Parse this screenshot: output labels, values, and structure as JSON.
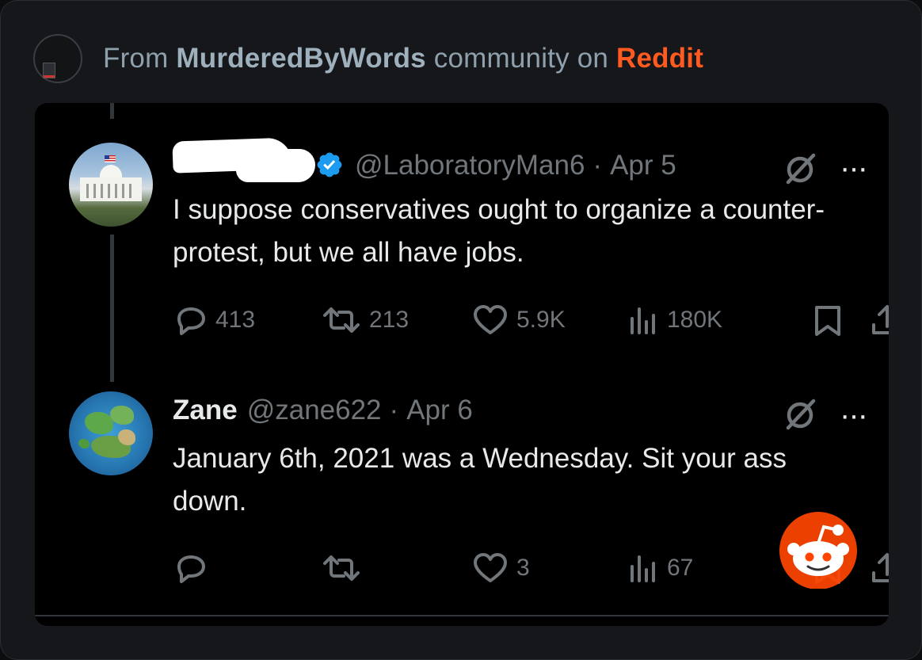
{
  "source": {
    "prefix": "From ",
    "community": "MurderedByWords",
    "middle": " community on ",
    "platform": "Reddit"
  },
  "tweets": [
    {
      "handle": "@LaboratoryMan6",
      "dot": "·",
      "date": "Apr 5",
      "text": "I suppose conservatives ought to organize a counter-protest, but we all have jobs.",
      "replies": "413",
      "retweets": "213",
      "likes": "5.9K",
      "views": "180K"
    },
    {
      "name": "Zane",
      "handle": "@zane622",
      "dot": "·",
      "date": "Apr 6",
      "text": "January 6th, 2021 was a Wednesday. Sit your ass down.",
      "replies": "",
      "retweets": "",
      "likes": "3",
      "views": "67"
    }
  ],
  "icons": {
    "reply": "reply-icon",
    "retweet": "retweet-icon",
    "like": "heart-icon",
    "views": "views-icon",
    "bookmark": "bookmark-icon",
    "share": "share-icon",
    "grok": "grok-icon",
    "more": "more-icon",
    "verified": "verified-badge-icon"
  },
  "colors": {
    "reddit_orange": "#ff4500",
    "verified_blue": "#1d9bf0",
    "muted": "#71767b",
    "text": "#e7e9ea"
  }
}
